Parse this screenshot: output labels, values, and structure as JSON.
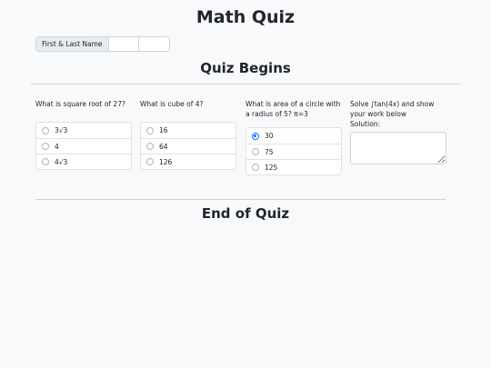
{
  "header": {
    "title": "Math Quiz"
  },
  "name_field": {
    "label": "First & Last Name",
    "first_value": "",
    "last_value": ""
  },
  "sections": {
    "begin": "Quiz Begins",
    "end": "End of Quiz"
  },
  "questions": [
    {
      "text": "What is square root of 27?",
      "options": [
        "3√3",
        "4",
        "4√3"
      ],
      "selected": null
    },
    {
      "text": "What is cube of 4?",
      "options": [
        "16",
        "64",
        "126"
      ],
      "selected": null
    },
    {
      "text": "What is area of a circle with a radius of 5? π=3",
      "options": [
        "30",
        "75",
        "125"
      ],
      "selected": "30"
    },
    {
      "text": "Solve ∫tan(4x) and show your work below",
      "solution_label": "Solution:",
      "solution_value": ""
    }
  ],
  "colors": {
    "accent": "#0d6efd",
    "background": "#f8f9fa"
  }
}
